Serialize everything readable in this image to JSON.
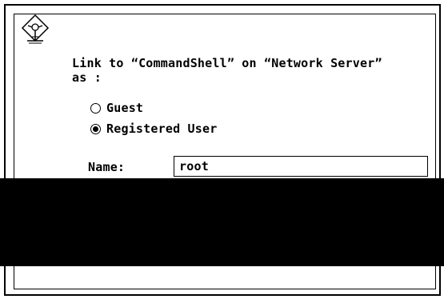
{
  "dialog": {
    "message_line1": "Link to “CommandShell” on “Network Server”",
    "message_line2": "as :",
    "options": [
      {
        "label": "Guest",
        "selected": false
      },
      {
        "label": "Registered User",
        "selected": true
      }
    ],
    "name_label": "Name:",
    "name_value": "root"
  },
  "colors": {
    "background": "#ffffff",
    "foreground": "#000000",
    "redaction": "#000000"
  },
  "icons": {
    "link_icon": "network-link-icon"
  }
}
